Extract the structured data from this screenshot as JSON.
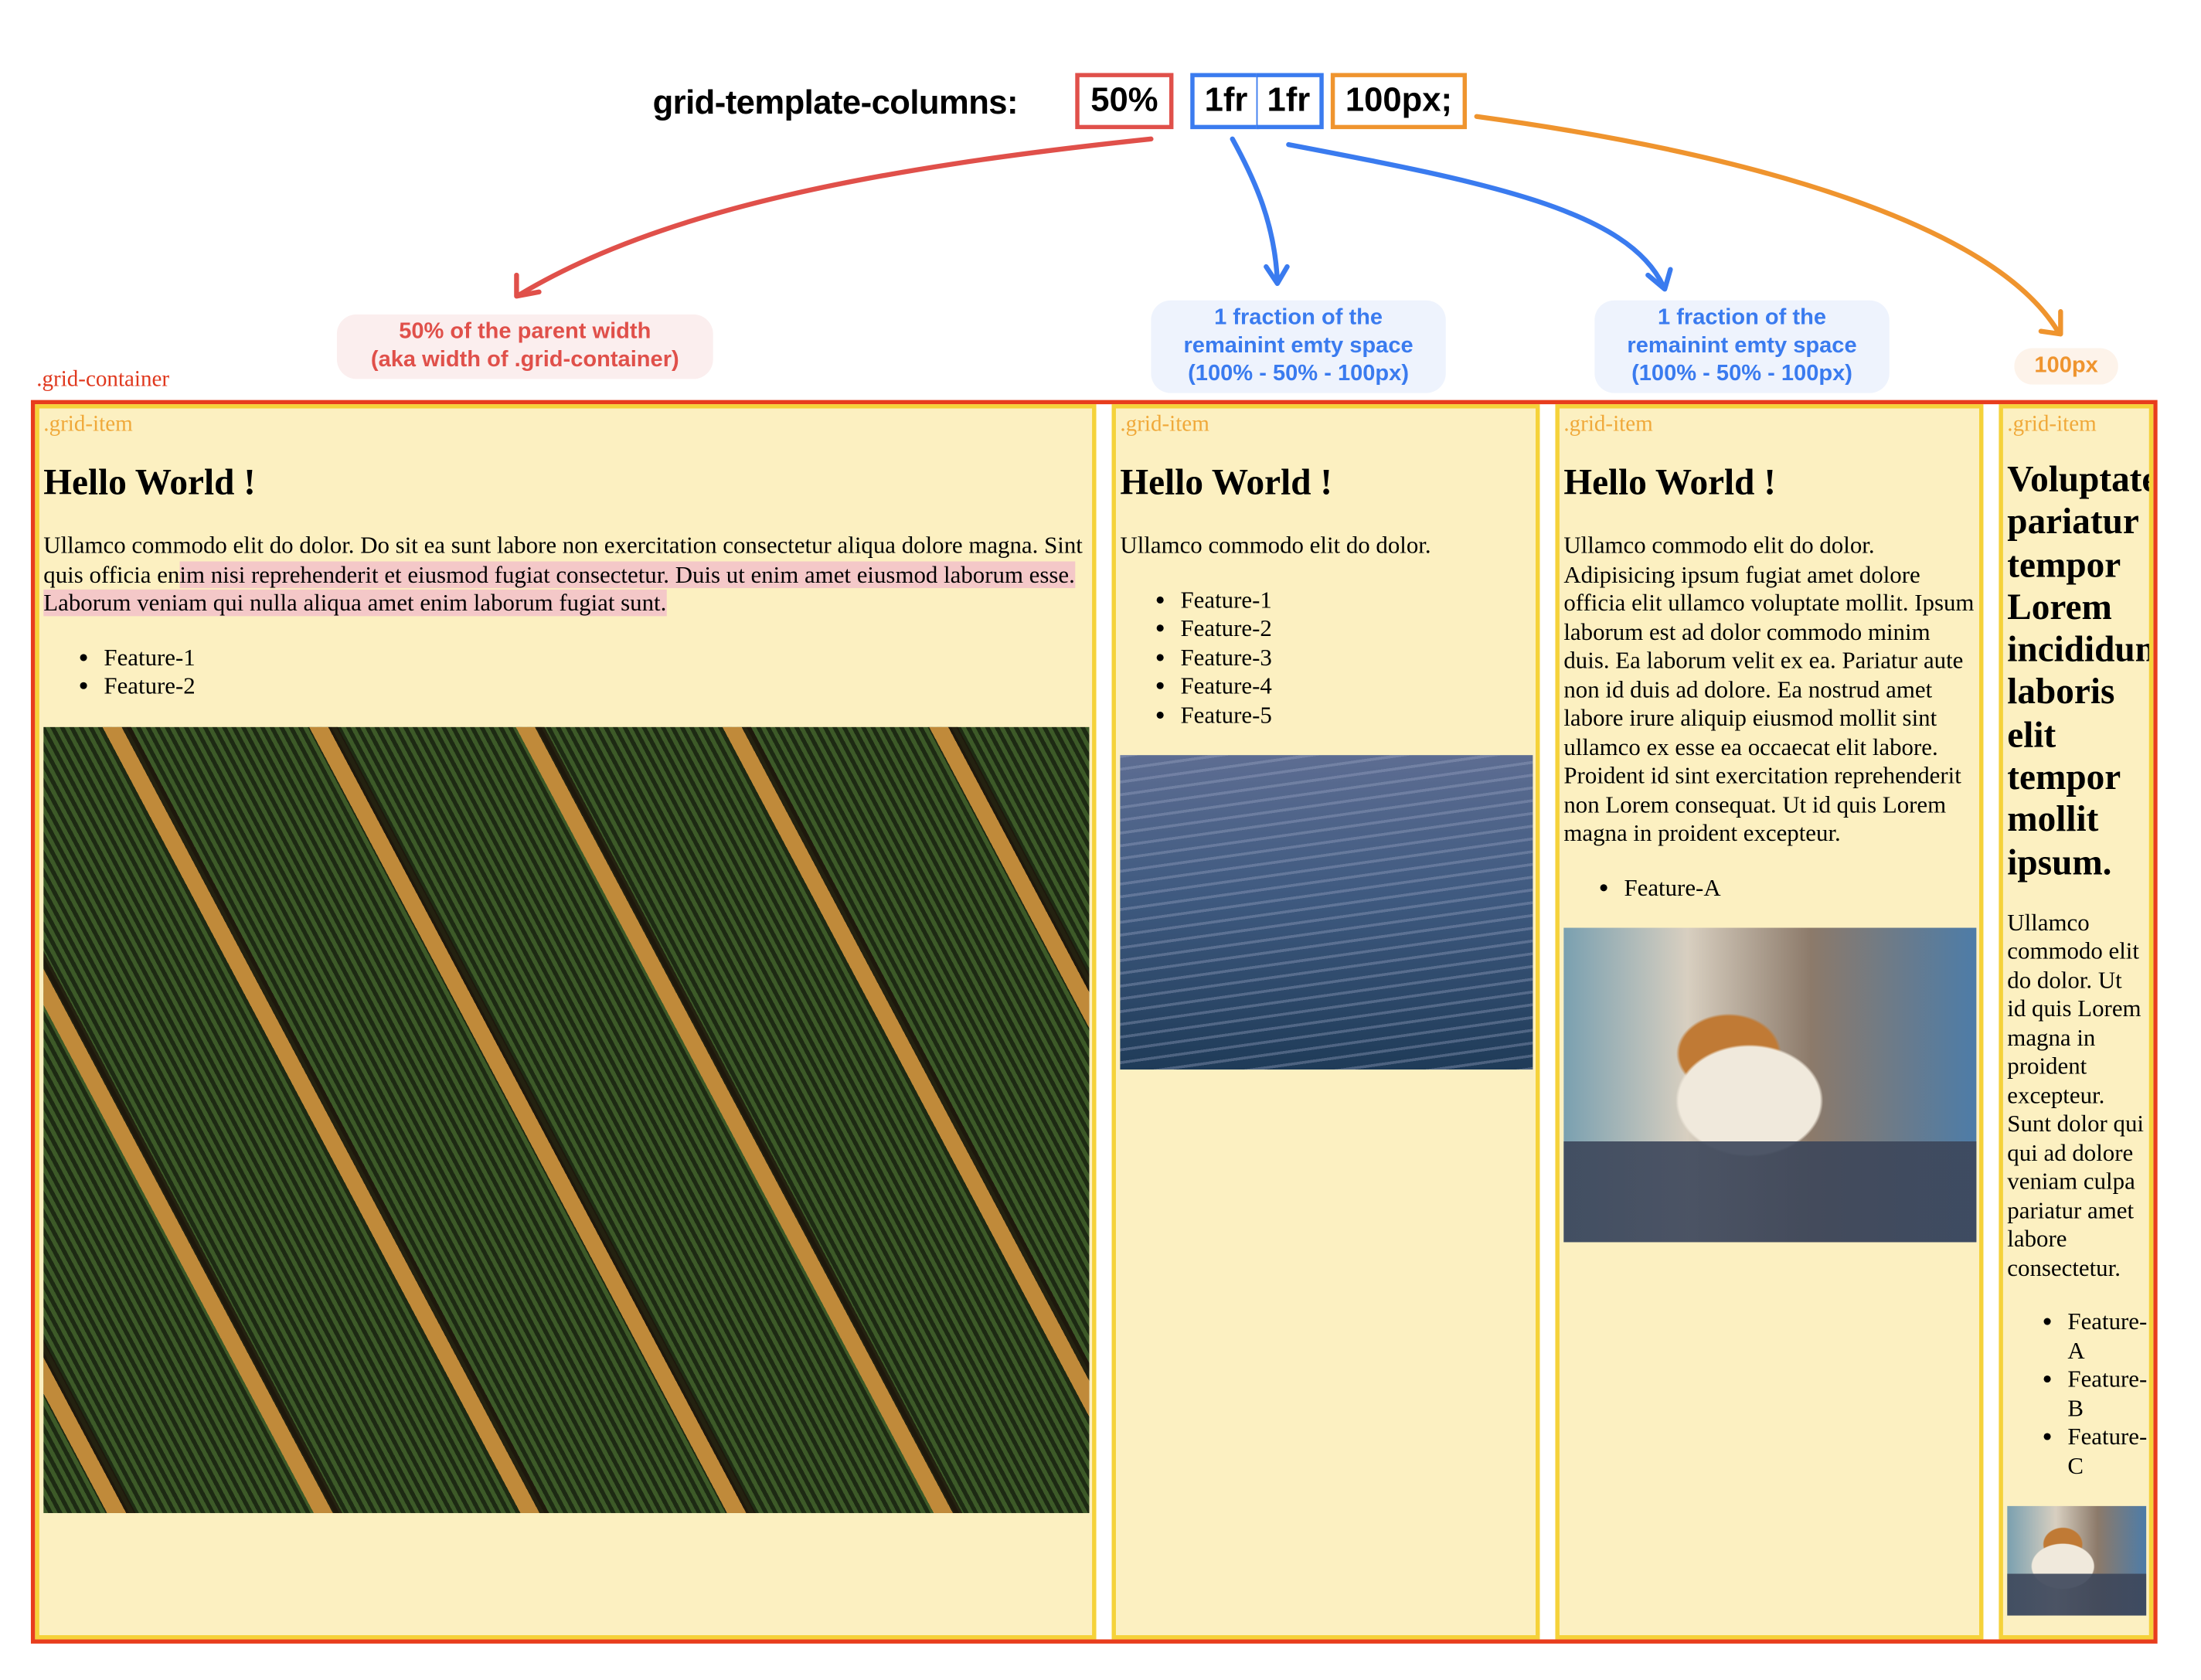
{
  "header": {
    "property_label": "grid-template-columns:",
    "values": [
      {
        "text": "50%",
        "color": "#e0504a"
      },
      {
        "text": "1fr",
        "color": "#3a7bef"
      },
      {
        "text": "1fr",
        "color": "#3a7bef"
      },
      {
        "text": "100px;",
        "color": "#ef942e"
      }
    ]
  },
  "annotations": {
    "col1": [
      "50% of the parent width",
      "(aka width of .grid-container)"
    ],
    "col2": [
      "1 fraction of the",
      "remainint emty space",
      "(100% - 50% - 100px)"
    ],
    "col3": [
      "1 fraction of the",
      "remainint emty space",
      "(100% - 50% - 100px)"
    ],
    "col4": [
      "100px"
    ]
  },
  "container": {
    "label": ".grid-container",
    "border_color": "#e83d1d",
    "item_border_color": "#f5d23a",
    "item_bg_color": "#fcf0c1"
  },
  "items": [
    {
      "label": ".grid-item",
      "heading": "Hello World !",
      "paragraph_plain": "Ullamco commodo elit do dolor. Do sit ea sunt labore non exercitation consectetur aliqua dolore magna. Sint quis officia en",
      "paragraph_highlight": "im nisi reprehenderit et eiusmod fugiat consectetur. Duis ut enim amet eiusmod laborum esse. Laborum veniam qui nulla aliqua amet enim laborum fugiat sunt.",
      "features": [
        "Feature-1",
        "Feature-2"
      ],
      "image": "aerial-field-photo"
    },
    {
      "label": ".grid-item",
      "heading": "Hello World !",
      "paragraph": "Ullamco commodo elit do dolor.",
      "features": [
        "Feature-1",
        "Feature-2",
        "Feature-3",
        "Feature-4",
        "Feature-5"
      ],
      "image": "sea-water-photo"
    },
    {
      "label": ".grid-item",
      "heading": "Hello World !",
      "paragraph": "Ullamco commodo elit do dolor. Adipisicing ipsum fugiat amet dolore officia elit ullamco voluptate mollit. Ipsum laborum est ad dolor commodo minim duis. Ea laborum velit ex ea. Pariatur aute non id duis ad dolore. Ea nostrud amet labore irure aliquip eiusmod mollit sint ullamco ex esse ea occaecat elit labore. Proident id sint exercitation reprehenderit non Lorem consequat. Ut id quis Lorem magna in proident excepteur.",
      "features": [
        "Feature-A"
      ],
      "image": "sailboat-harbor-photo"
    },
    {
      "label": ".grid-item",
      "heading": "Voluptate pariatur tempor Lorem incididunt laboris elit tempor mollit ipsum.",
      "paragraph": "Ullamco commodo elit do dolor. Ut id quis Lorem magna in proident excepteur. Sunt dolor qui qui ad dolore veniam culpa pariatur amet labore consectetur.",
      "features": [
        "Feature-A",
        "Feature-B",
        "Feature-C"
      ],
      "image": "sailboat-harbor-photo"
    }
  ]
}
